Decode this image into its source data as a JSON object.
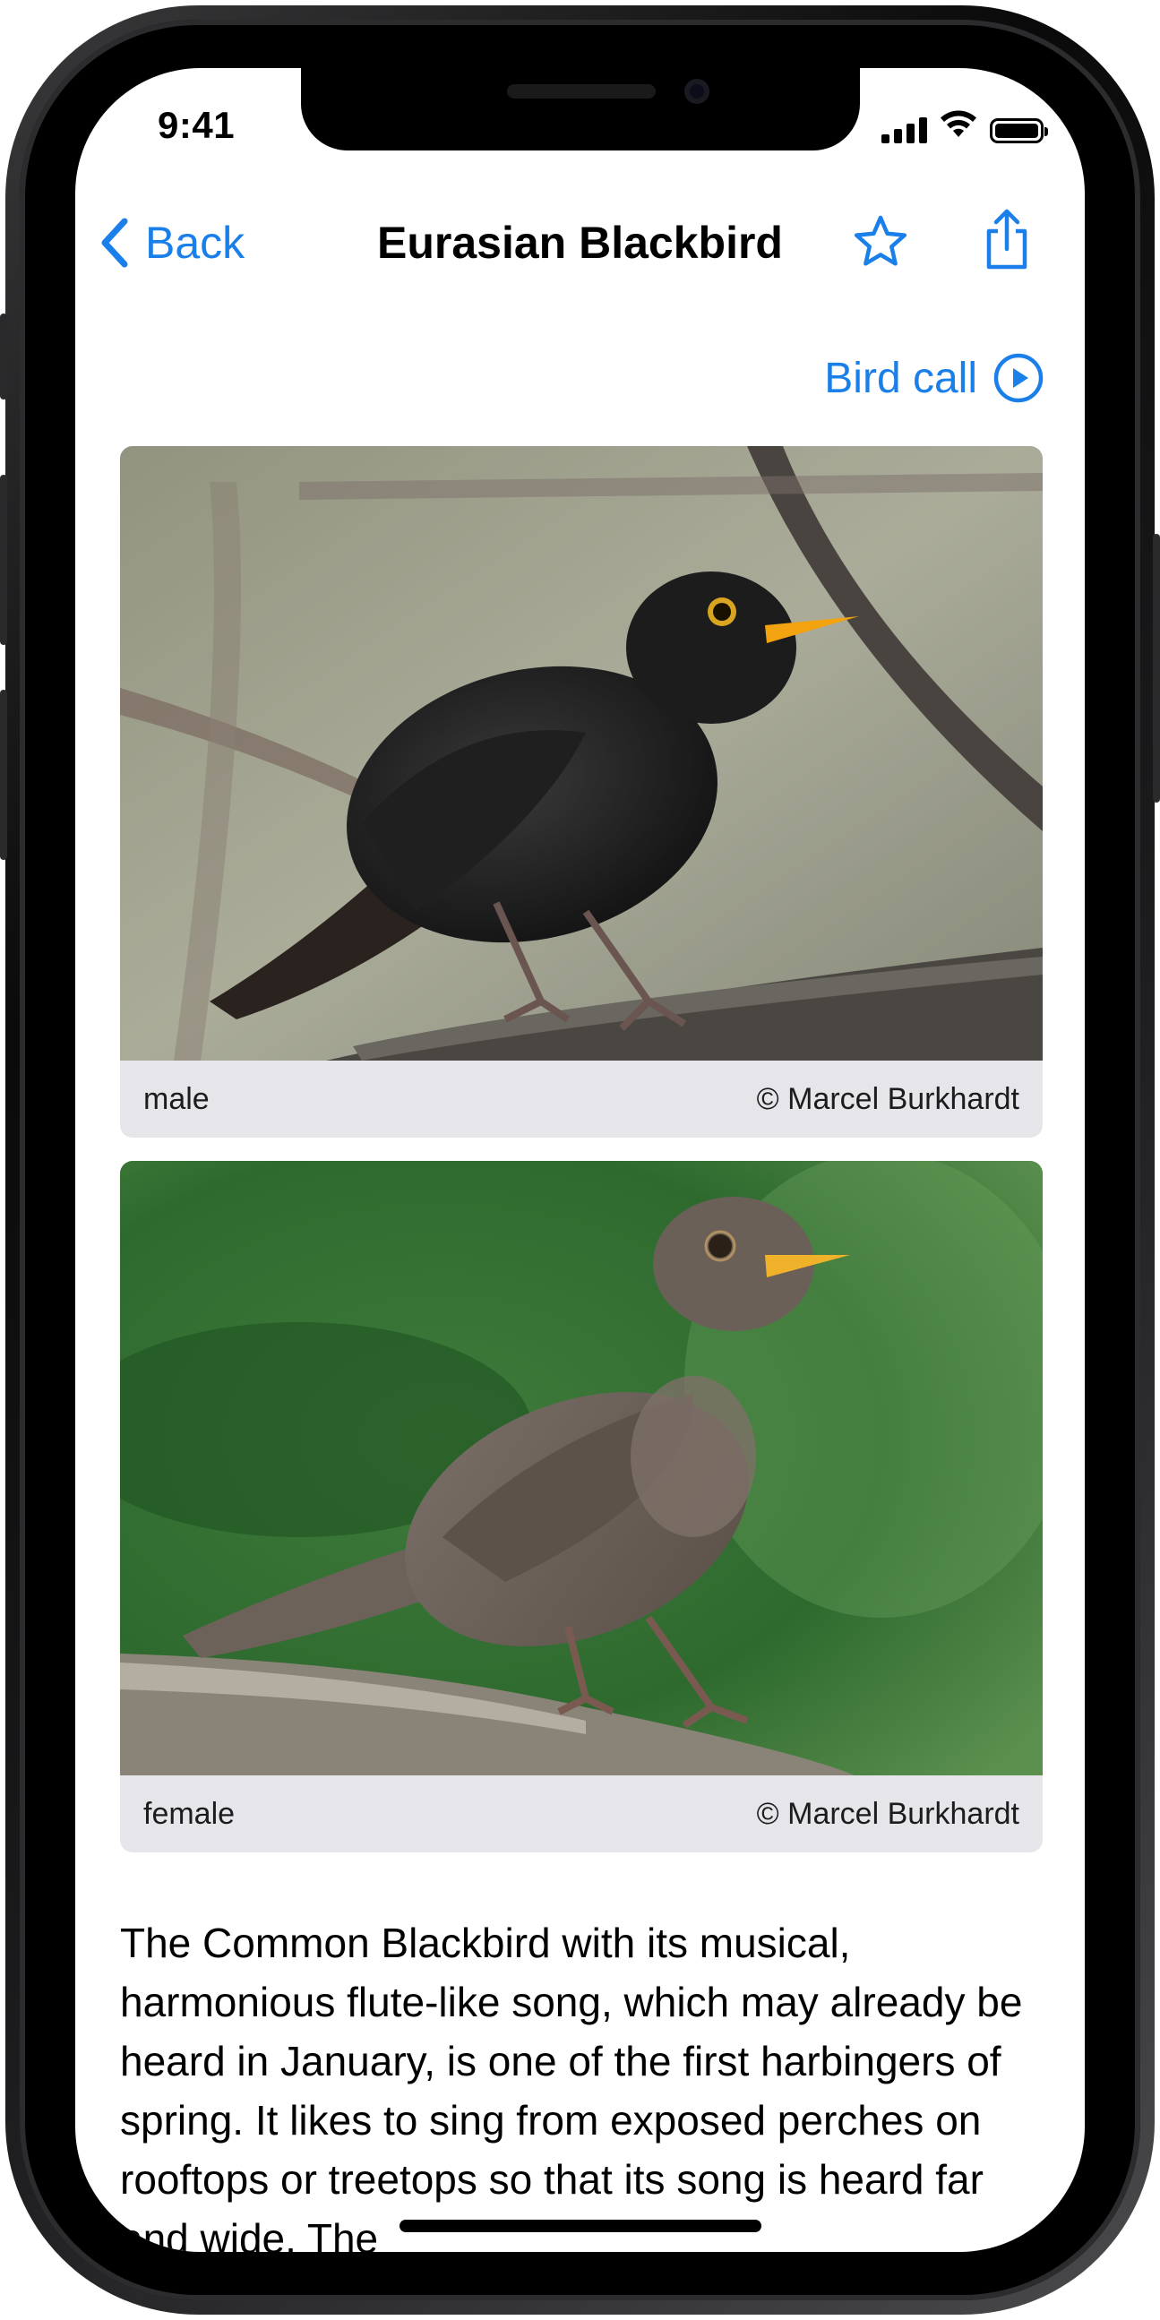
{
  "status_bar": {
    "time": "9:41"
  },
  "nav": {
    "back_label": "Back",
    "title": "Eurasian Blackbird"
  },
  "bird_call": {
    "label": "Bird call"
  },
  "photos": [
    {
      "caption": "male",
      "credit": "© Marcel Burkhardt"
    },
    {
      "caption": "female",
      "credit": "© Marcel Burkhardt"
    }
  ],
  "description": "The Common Blackbird with its musical, harmonious flute-like song, which may already be heard in January, is one of the first harbingers of spring. It likes to sing from exposed perches on rooftops or treetops so that its song is heard far and wide. The",
  "colors": {
    "accent": "#1a7fe8",
    "caption_bg": "#e5e5ea"
  }
}
